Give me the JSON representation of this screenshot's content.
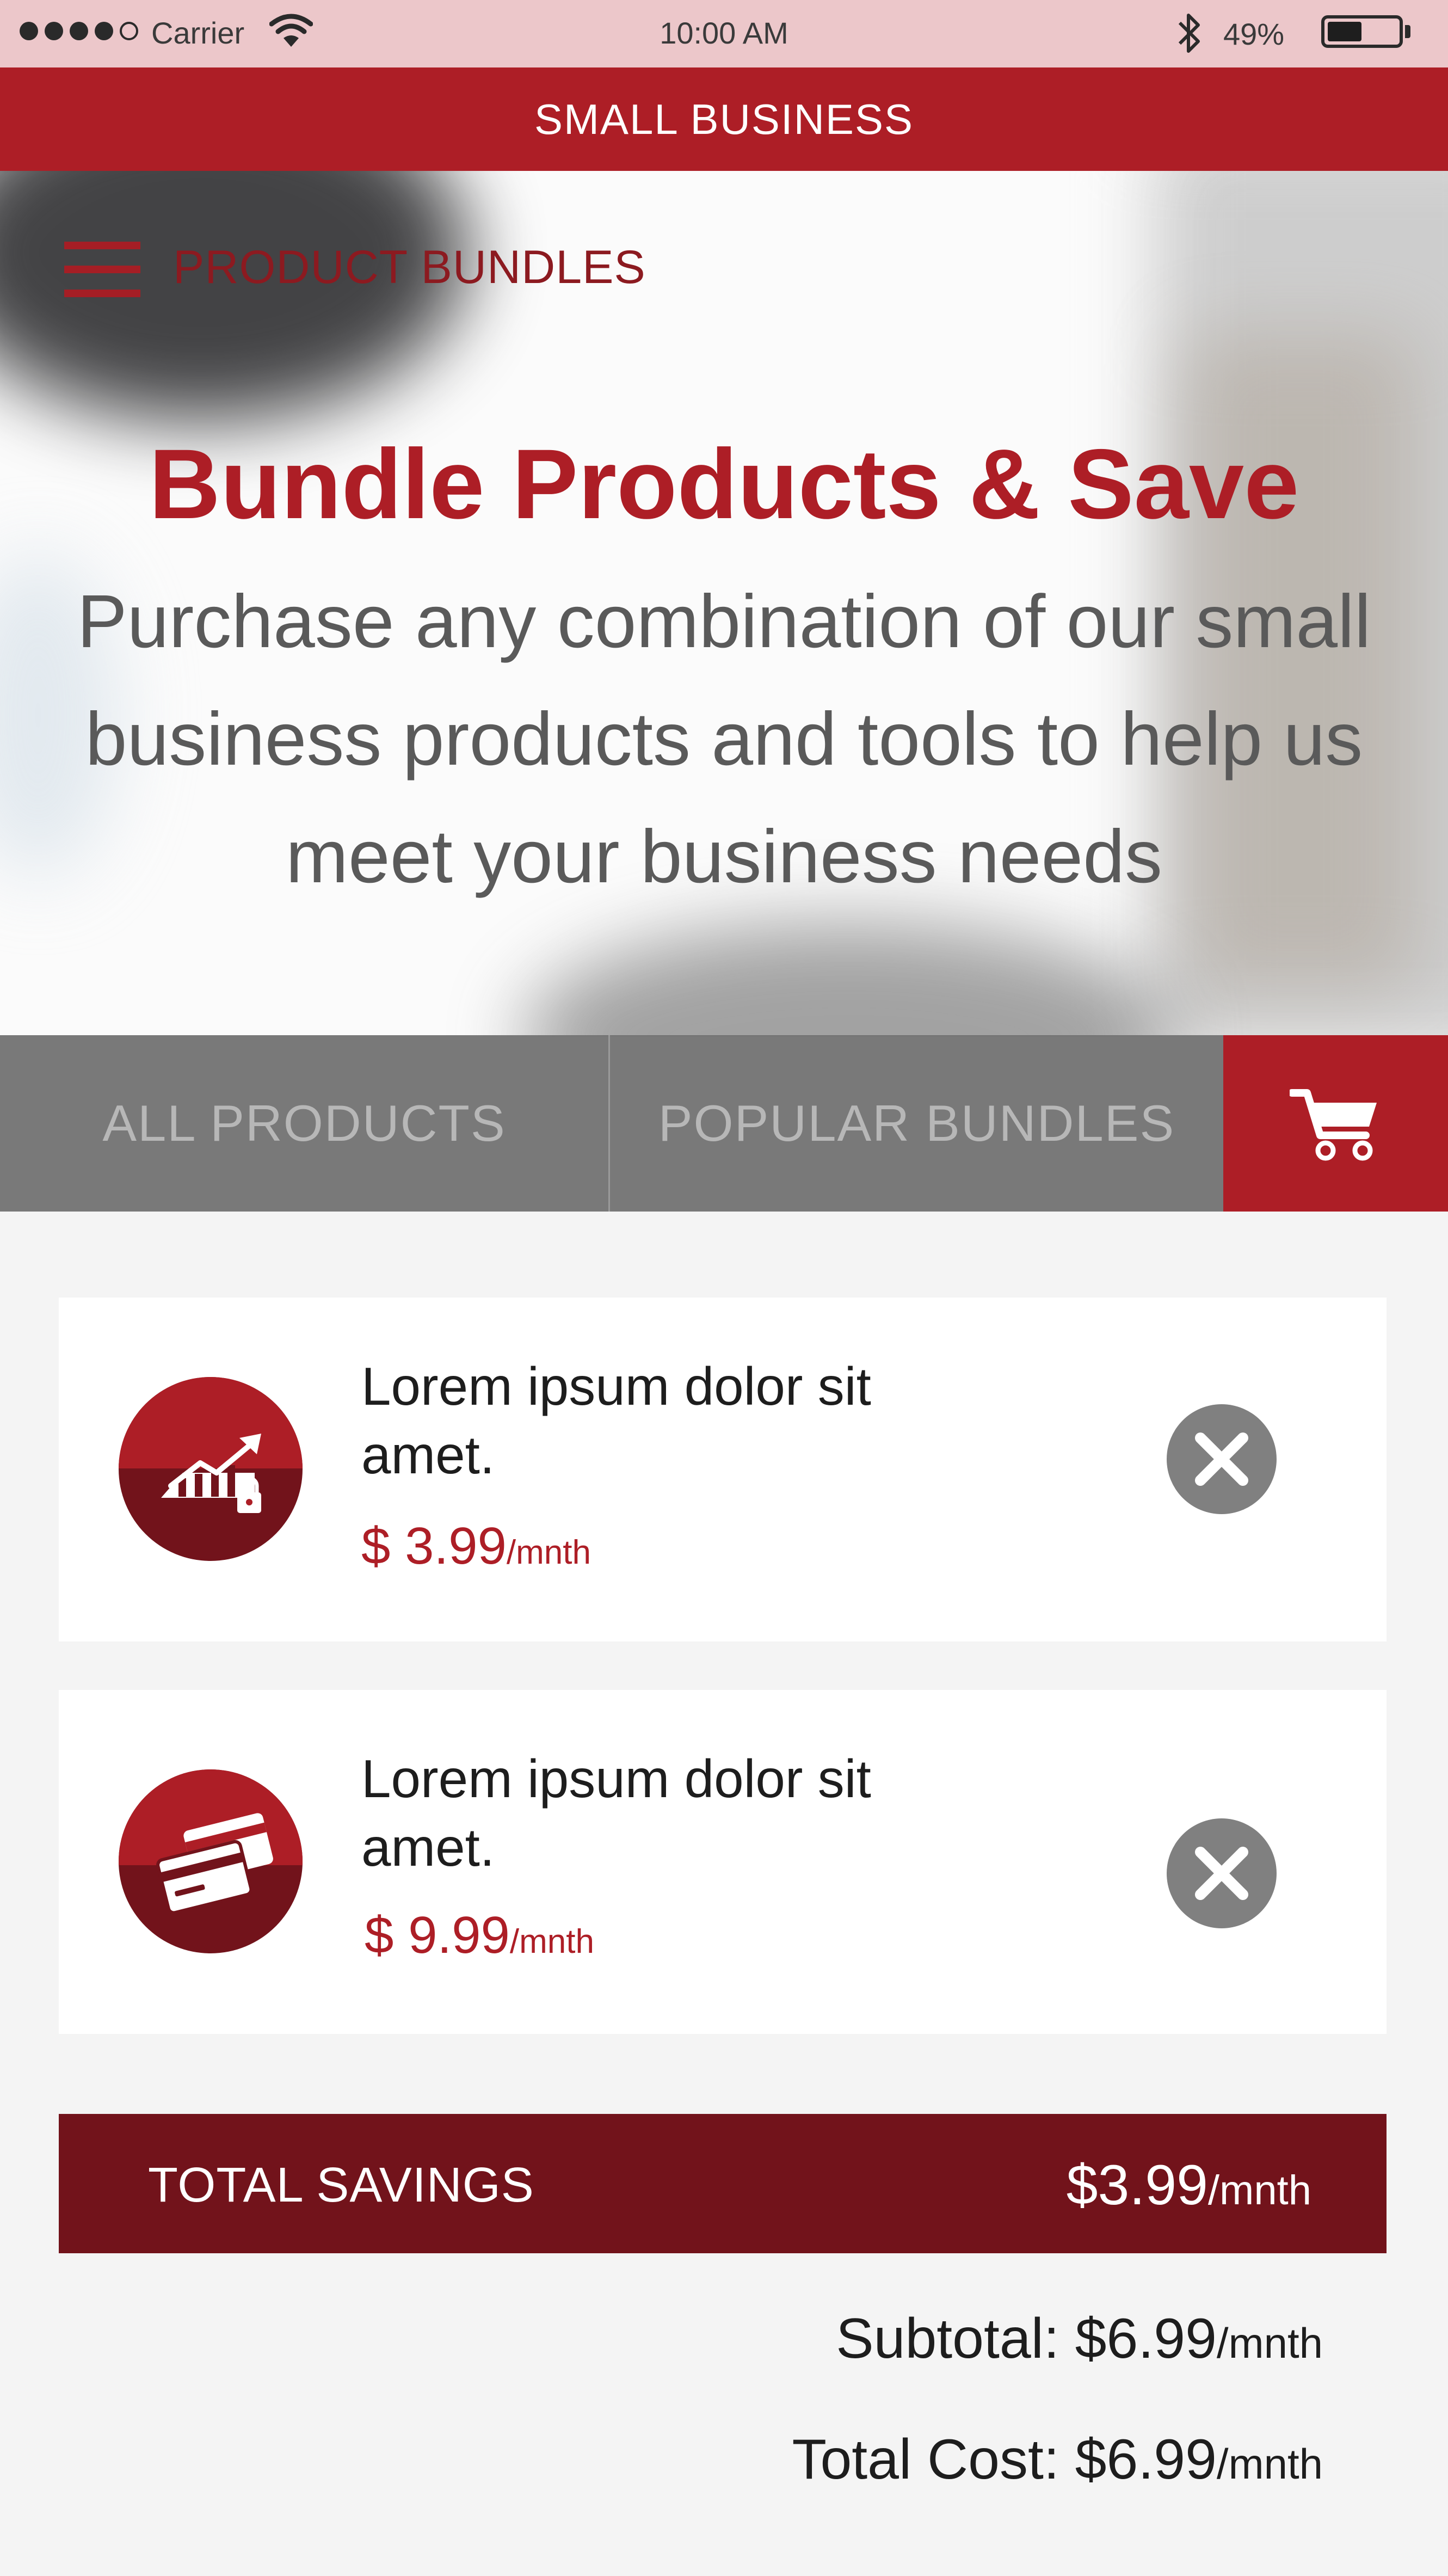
{
  "status_bar": {
    "carrier": "Carrier",
    "time": "10:00 AM",
    "battery_text": "49%",
    "battery_level": 0.49
  },
  "top_bar": {
    "title": "SMALL BUSINESS"
  },
  "hero": {
    "nav_title": "PRODUCT BUNDLES",
    "title": "Bundle Products & Save",
    "subtitle": "Purchase any combination of our small business products and tools to help us meet your business needs"
  },
  "tabs": [
    {
      "label": "ALL PRODUCTS"
    },
    {
      "label": "POPULAR BUNDLES"
    }
  ],
  "cart": {
    "icon": "cart-icon"
  },
  "bundle_items": [
    {
      "name": "Lorem ipsum dolor sit amet.",
      "price": "$ 3.99",
      "period": "/mnth",
      "icon": "growth-chart-lock-icon"
    },
    {
      "name": "Lorem ipsum dolor sit amet.",
      "price": "$ 9.99",
      "period": "/mnth",
      "icon": "credit-cards-icon"
    }
  ],
  "totals": {
    "savings_label": "TOTAL SAVINGS",
    "savings_value": "$3.99",
    "savings_period": "/mnth",
    "subtotal_label": "Subtotal:",
    "subtotal_value": "$6.99",
    "subtotal_period": "/mnth",
    "total_label": "Total Cost:",
    "total_value": "$6.99",
    "total_period": "/mnth"
  },
  "colors": {
    "brand_red": "#ad1e26",
    "dark_red": "#72131b",
    "status_bar_bg": "#ecc7ca",
    "remove_grey": "#808080"
  }
}
